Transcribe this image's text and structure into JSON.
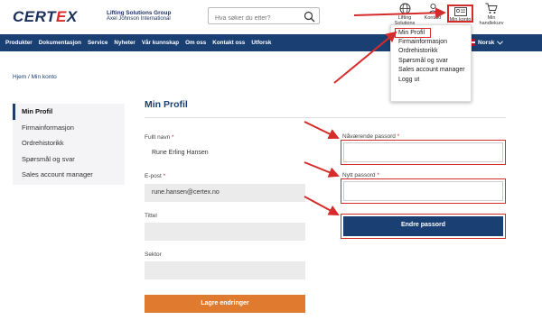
{
  "header": {
    "logo_text": "CERTEX",
    "tagline_1": "Lifting Solutions Group",
    "tagline_2": "Axel Johnson International",
    "search_placeholder": "Hva søker du etter?",
    "lifting_solutions_1": "Lifting",
    "lifting_solutions_2": "Solutions",
    "kontakt": "Kontakt",
    "min_konto": "Min konto",
    "cart_1": "Min",
    "cart_2": "handlekurv"
  },
  "nav": {
    "items": [
      "Produkter",
      "Dokumentasjon",
      "Service",
      "Nyheter",
      "Vår kunnskap",
      "Om oss",
      "Kontakt oss",
      "Utforsk"
    ],
    "language": "Norsk"
  },
  "dropdown": {
    "items": [
      "Min Profil",
      "Firmainformasjon",
      "Ordrehistorikk",
      "Spørsmål og svar",
      "Sales account manager",
      "Logg ut"
    ]
  },
  "breadcrumb": "Hjem / Min konto",
  "sidebar": {
    "items": [
      "Min Profil",
      "Firmainformasjon",
      "Ordrehistorikk",
      "Spørsmål og svar",
      "Sales account manager"
    ]
  },
  "main": {
    "title": "Min Profil",
    "full_name_label": "Fullt navn",
    "full_name_value": "Rune Erling Hansen",
    "email_label": "E-post",
    "email_value": "rune.hansen@certex.no",
    "title_label": "Tittel",
    "title_value": "",
    "sector_label": "Sektor",
    "sector_value": "",
    "save_button": "Lagre endringer",
    "current_pw_label": "Nåværende passord",
    "new_pw_label": "Nytt passord",
    "change_pw_button": "Endre passord",
    "required_mark": "*"
  },
  "colors": {
    "brand_blue": "#1a3f73",
    "annotation_red": "#d62b2b",
    "save_orange": "#e07a2e"
  }
}
